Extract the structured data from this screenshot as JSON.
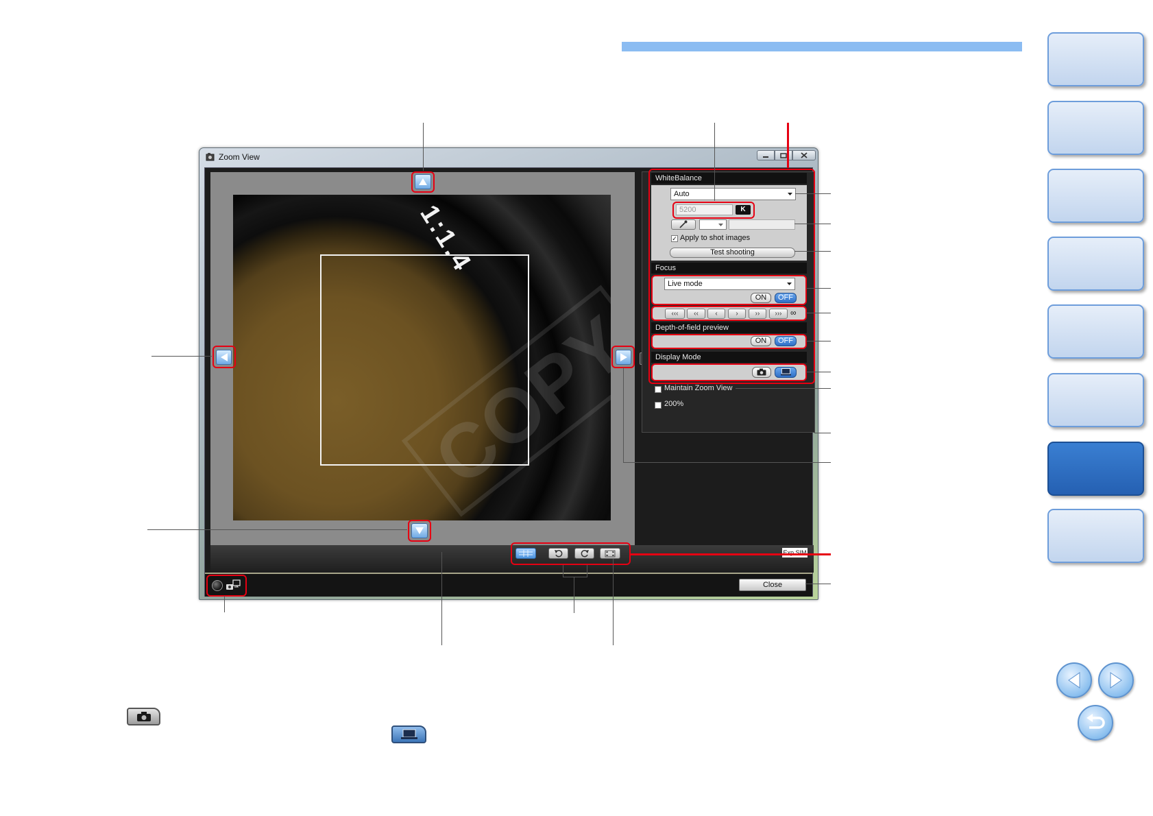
{
  "window": {
    "title": "Zoom View",
    "controls": [
      "minimize-icon",
      "maximize-icon",
      "close-icon"
    ]
  },
  "image": {
    "lens_marking": "1:1.4",
    "watermark": "COPY",
    "navigation_icons": [
      "up-arrow-icon",
      "down-arrow-icon",
      "left-arrow-icon",
      "right-arrow-icon"
    ]
  },
  "white_balance": {
    "header": "WhiteBalance",
    "preset": "Auto",
    "color_temp": "5200",
    "kelvin_button": "K",
    "apply_label": "Apply to shot images",
    "apply_checked": true,
    "test_shooting": "Test shooting"
  },
  "focus": {
    "header": "Focus",
    "mode": "Live mode",
    "on": "ON",
    "off": "OFF",
    "state": "OFF",
    "buttons": [
      "‹‹‹",
      "‹‹",
      "‹",
      "›",
      "››",
      "›››"
    ],
    "infinity": "∞"
  },
  "depth_of_field": {
    "header": "Depth-of-field preview",
    "on": "ON",
    "off": "OFF",
    "state": "OFF"
  },
  "display_mode": {
    "header": "Display Mode",
    "options": [
      "camera-icon",
      "monitor-icon"
    ],
    "selected": "monitor-icon"
  },
  "options": {
    "maintain_zoom_view": "Maintain Zoom View",
    "maintain_checked": false,
    "zoom_200": "200%",
    "zoom_200_checked": false
  },
  "toolbar": {
    "buttons": [
      "grid-icon",
      "rotate-left-icon",
      "rotate-right-icon",
      "fullscreen-icon"
    ],
    "exp_sim": "Exp.SIM",
    "close": "Close"
  },
  "status": {
    "icons": [
      "lamp-icon",
      "camera-to-pc-icon"
    ]
  },
  "side_tabs": [
    "inactive",
    "inactive",
    "inactive",
    "inactive",
    "inactive",
    "inactive",
    "active",
    "inactive"
  ],
  "page_nav": [
    "previous-page-icon",
    "next-page-icon",
    "return-icon"
  ],
  "legend_icons": [
    "camera-icon",
    "monitor-icon"
  ],
  "colors": {
    "annotation_red": "#e60012",
    "header_bar": "#8bbcf2",
    "selected_blue": "#2f6fc6",
    "active_tab": "#2d6fc2"
  }
}
